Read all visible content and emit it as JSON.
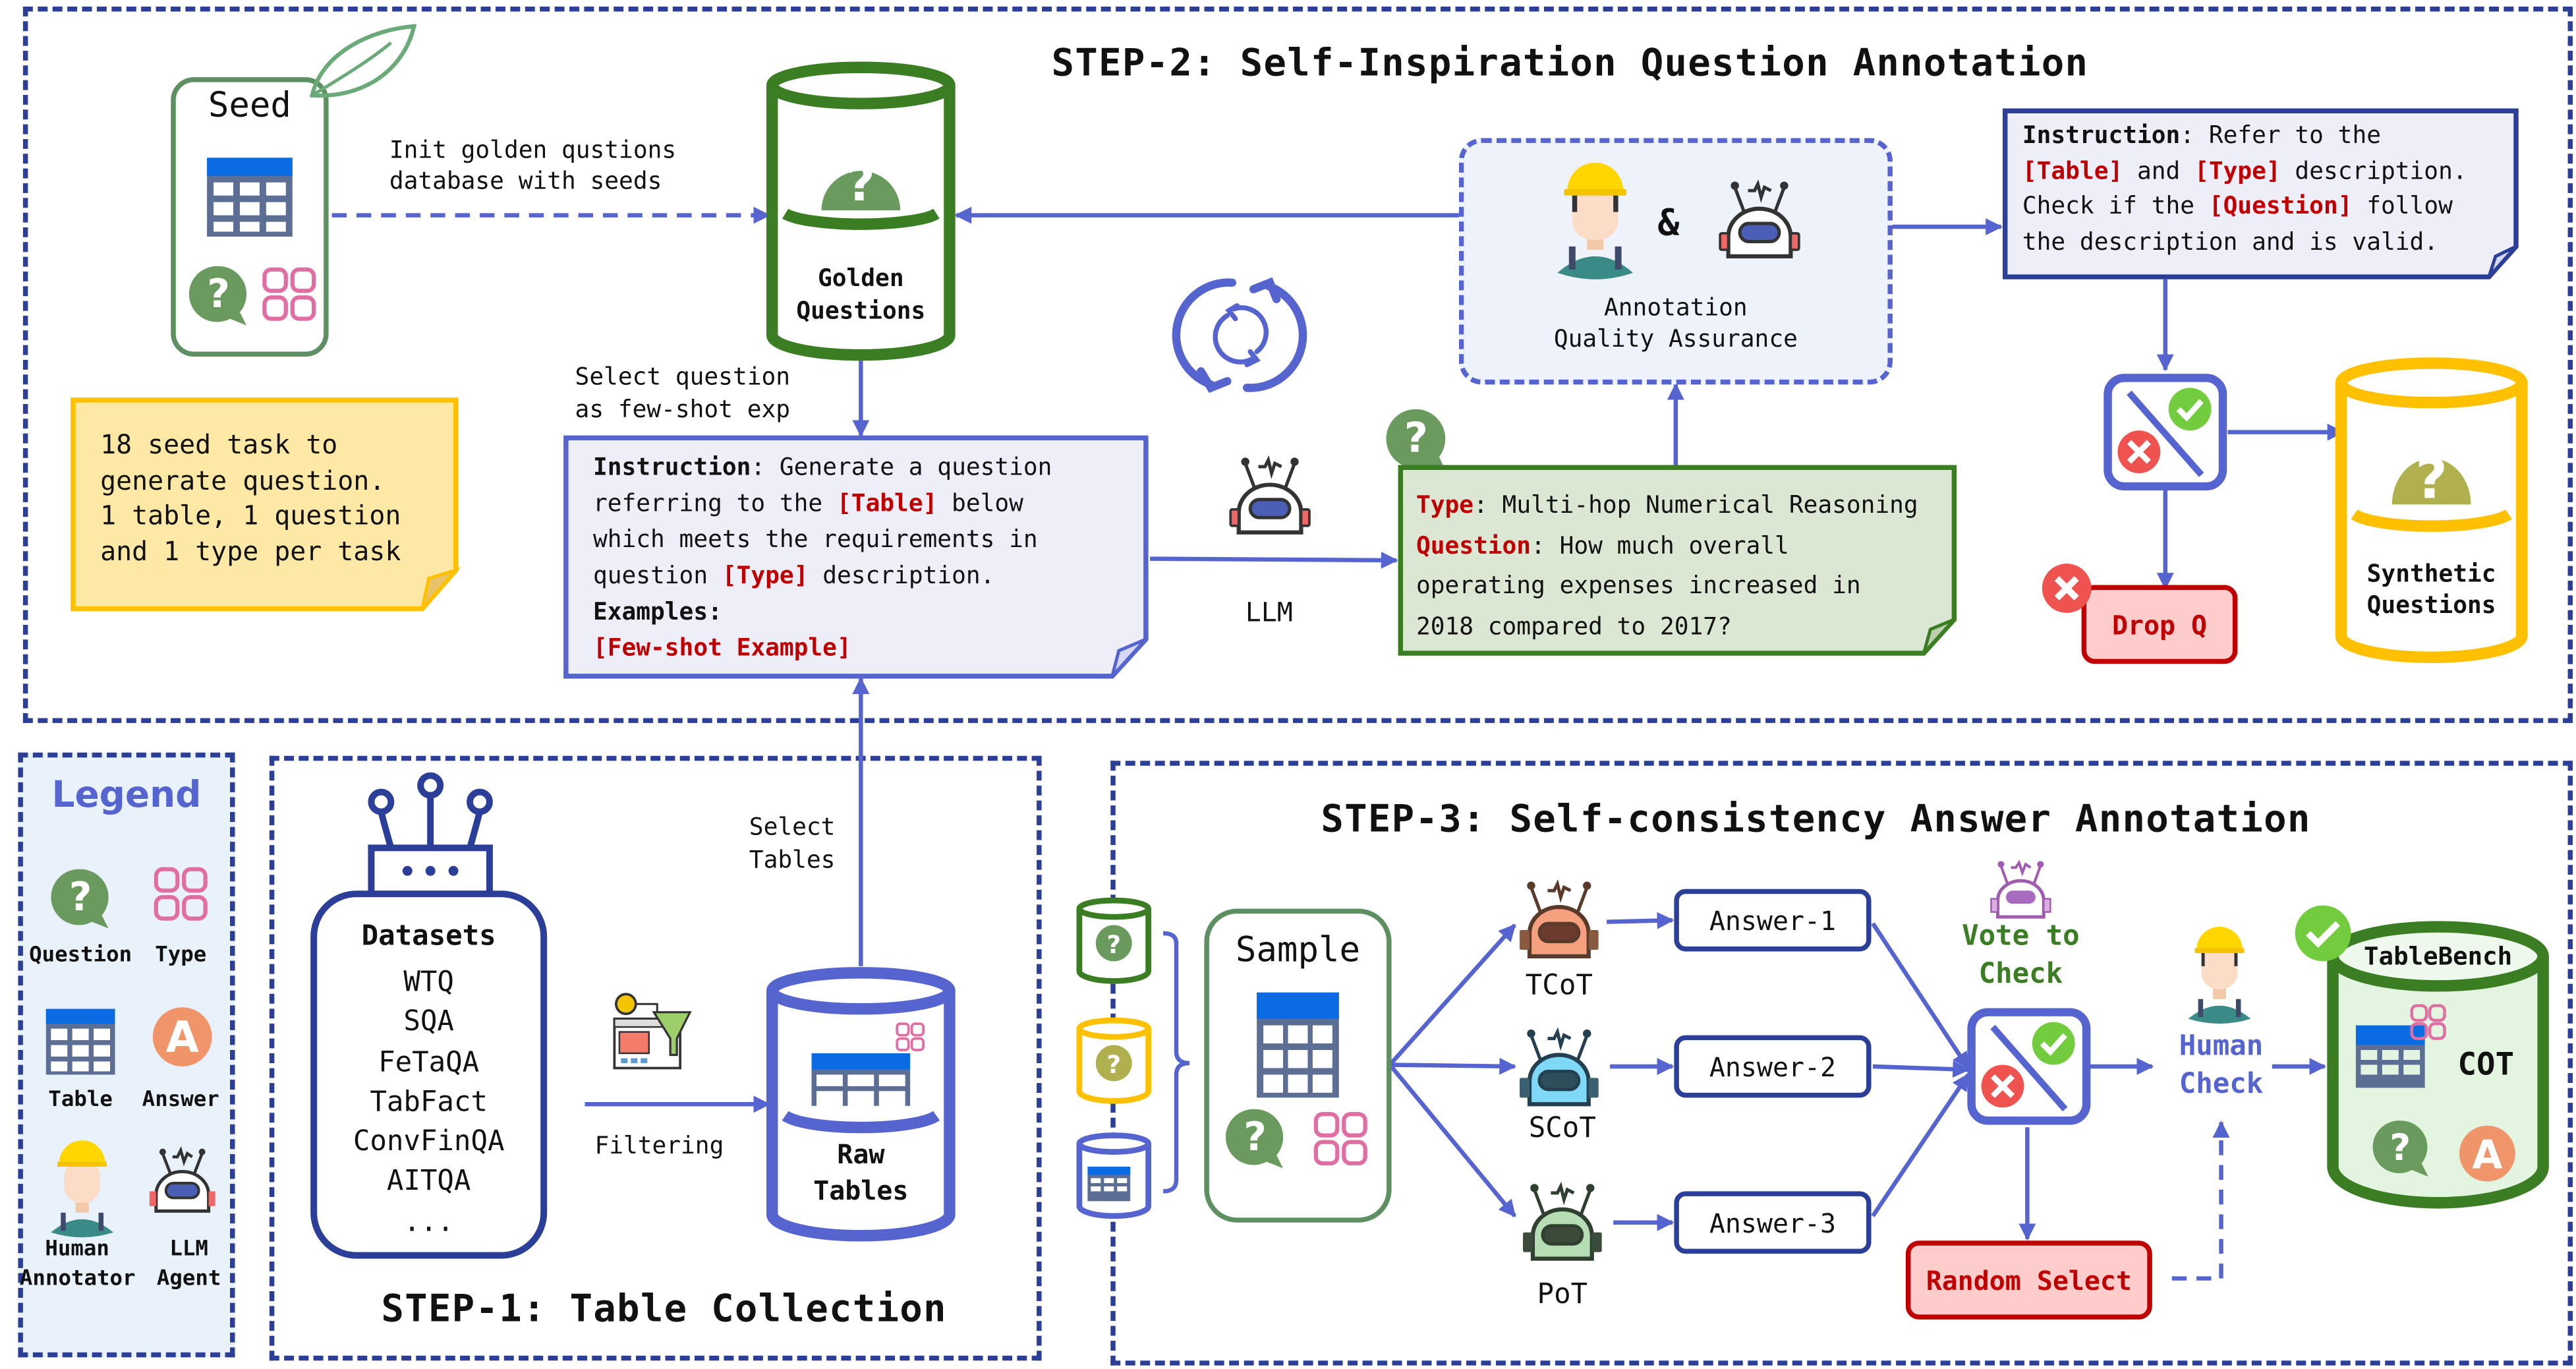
{
  "step2": {
    "title": "STEP-2: Self-Inspiration Question Annotation",
    "seed_label": "Seed",
    "init_arrow_label": [
      "Init golden qustions",
      "database with seeds"
    ],
    "golden_db": [
      "Golden",
      "Questions"
    ],
    "seed_note": [
      "18 seed task to",
      "generate question.",
      "1 table, 1 question",
      "and 1 type per task"
    ],
    "select_label": [
      "Select question",
      "as few-shot exp"
    ],
    "gen_prompt": {
      "instruction_key": "Instruction",
      "line1": ": Generate a question",
      "line2a": "referring to the ",
      "table_tag": "[Table]",
      "line2b": " below",
      "line3": "which meets the requirements in",
      "line4a": "question ",
      "type_tag": "[Type]",
      "line4b": " description.",
      "examples_key": "Examples:",
      "fewshot_tag": "[Few-shot Example]"
    },
    "llm_label": "LLM",
    "generated": {
      "type_key": "Type",
      "type_value": ": Multi-hop Numerical Reasoning",
      "question_key": "Question",
      "question_value": ": How much overall",
      "line3": "operating expenses increased in",
      "line4": "2018 compared to 2017?"
    },
    "qa_box": {
      "amp": "&",
      "label": [
        "Annotation",
        "Quality Assurance"
      ]
    },
    "check_prompt": {
      "instruction_key": "Instruction",
      "line1": ": Refer to the",
      "table_tag": "[Table]",
      "and": " and ",
      "type_tag": "[Type]",
      "line2b": " description.",
      "line3a": "Check if the ",
      "question_tag": "[Question]",
      "line3b": " follow",
      "line4": "the description and is valid."
    },
    "drop_label": "Drop Q",
    "synthetic_db": [
      "Synthetic",
      "Questions"
    ]
  },
  "legend": {
    "title": "Legend",
    "items": [
      {
        "label": "Question",
        "icon": "question-bubble-icon"
      },
      {
        "label": "Type",
        "icon": "type-grid-icon"
      },
      {
        "label": "Table",
        "icon": "table-icon"
      },
      {
        "label": "Answer",
        "icon": "answer-a-icon"
      },
      {
        "label": "Human\nAnnotator",
        "icon": "human-annotator-icon"
      },
      {
        "label": "LLM\nAgent",
        "icon": "llm-robot-icon"
      }
    ]
  },
  "step1": {
    "title": "STEP-1: Table Collection",
    "datasets_title": "Datasets",
    "datasets": [
      "WTQ",
      "SQA",
      "FeTaQA",
      "TabFact",
      "ConvFinQA",
      "AITQA",
      "..."
    ],
    "filter_label": "Filtering",
    "select_tables_label": [
      "Select",
      "Tables"
    ],
    "raw_db": [
      "Raw",
      "Tables"
    ]
  },
  "step3": {
    "title": "STEP-3: Self-consistency Answer Annotation",
    "sample_label": "Sample",
    "agents": [
      {
        "name": "TCoT",
        "color": "#f5a07e"
      },
      {
        "name": "SCoT",
        "color": "#7fd8f5"
      },
      {
        "name": "PoT",
        "color": "#b7ddb5"
      }
    ],
    "answers": [
      "Answer-1",
      "Answer-2",
      "Answer-3"
    ],
    "vote_label": [
      "Vote to",
      "Check"
    ],
    "human_check": [
      "Human",
      "Check"
    ],
    "random_select": "Random Select",
    "tablebench": {
      "name": "TableBench",
      "cot": "COT"
    }
  },
  "colors": {
    "dash_border": "#2b3f99",
    "arrow": "#5564cf",
    "green_db": "#3a7d23",
    "yellow_db": "#ffc000",
    "blue_db": "#5564cf",
    "red_tag": "#c00000",
    "question_green": "#6a9a5e",
    "type_pink": "#e06ea3",
    "answer_orange": "#f0956a",
    "check_green": "#72cc3d",
    "cross_red": "#ef5350"
  }
}
